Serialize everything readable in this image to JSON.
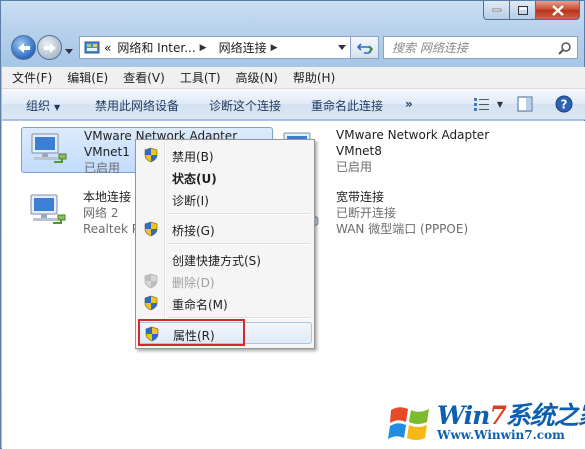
{
  "window": {
    "caption": {
      "minimize": "minimize",
      "maximize": "maximize",
      "close": "close"
    }
  },
  "address_bar": {
    "overflow_glyph": "«",
    "crumbs": [
      "网络和 Inter...",
      "网络连接"
    ],
    "search_placeholder": "搜索 网络连接"
  },
  "menubar": {
    "items": [
      "文件(F)",
      "编辑(E)",
      "查看(V)",
      "工具(T)",
      "高级(N)",
      "帮助(H)"
    ]
  },
  "toolbar": {
    "organize": "组织",
    "disable": "禁用此网络设备",
    "diagnose": "诊断这个连接",
    "rename": "重命名此连接",
    "more": "»"
  },
  "connections": [
    {
      "name": "VMware Network Adapter",
      "sub": "VMnet1",
      "status": "已启用"
    },
    {
      "name": "VMware Network Adapter",
      "sub": "VMnet8",
      "status": "已启用"
    },
    {
      "name": "本地连接",
      "sub": "网络  2",
      "status": "Realtek PCIe"
    },
    {
      "name": "宽带连接",
      "sub": "已断开连接",
      "status": "WAN 微型端口 (PPPOE)"
    }
  ],
  "context_menu": {
    "items": [
      {
        "label": "禁用(B)",
        "icon": "shield-icon"
      },
      {
        "label": "状态(U)",
        "icon": ""
      },
      {
        "label": "诊断(I)",
        "icon": ""
      },
      {
        "label": "桥接(G)",
        "icon": "shield-icon"
      },
      {
        "label": "创建快捷方式(S)",
        "icon": ""
      },
      {
        "label": "删除(D)",
        "icon": "shield-icon"
      },
      {
        "label": "重命名(M)",
        "icon": "shield-icon"
      },
      {
        "label": "属性(R)",
        "icon": "shield-icon"
      }
    ]
  },
  "watermark": {
    "brand_prefix": "Win",
    "brand_seven": "7",
    "brand_suffix": "系统之家",
    "url": "Www.Winwin7.com"
  },
  "colors": {
    "highlight": "#d8262b",
    "accent": "#0d5fb0"
  }
}
